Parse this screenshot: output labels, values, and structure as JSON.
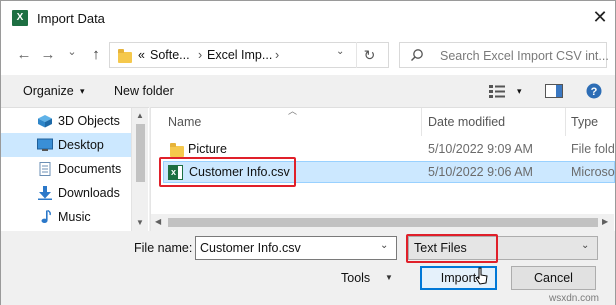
{
  "window": {
    "title": "Import Data",
    "close_glyph": "✕",
    "app_icon_letter": "X"
  },
  "nav": {
    "back_glyph": "←",
    "forward_glyph": "→",
    "recent_glyph": "⌄",
    "up_glyph": "↑",
    "breadcrumb_prefix": "«",
    "breadcrumbs": [
      "Softe...",
      "Excel Imp..."
    ],
    "crumb_sep": "›",
    "refresh_glyph": "↻",
    "search_placeholder": "Search Excel Import CSV int..."
  },
  "toolbar": {
    "organize_label": "Organize",
    "organize_caret": "▾",
    "new_folder_label": "New folder",
    "view_caret": "▾"
  },
  "sidebar": {
    "items": [
      {
        "label": "3D Objects",
        "icon": "3d-objects-icon"
      },
      {
        "label": "Desktop",
        "icon": "desktop-icon",
        "selected": true
      },
      {
        "label": "Documents",
        "icon": "documents-icon"
      },
      {
        "label": "Downloads",
        "icon": "downloads-icon"
      },
      {
        "label": "Music",
        "icon": "music-icon"
      }
    ]
  },
  "file_list": {
    "columns": [
      "Name",
      "Date modified",
      "Type"
    ],
    "rows": [
      {
        "name": "Picture",
        "date": "5/10/2022 9:09 AM",
        "type": "File fold",
        "icon": "folder-icon"
      },
      {
        "name": "Customer Info.csv",
        "date": "5/10/2022 9:06 AM",
        "type": "Microso",
        "icon": "excel-csv-icon",
        "selected": true
      }
    ]
  },
  "footer": {
    "file_name_label": "File name:",
    "file_name_value": "Customer Info.csv",
    "filter_value": "Text Files",
    "tools_label": "Tools",
    "import_label": "Import",
    "cancel_label": "Cancel"
  },
  "watermark": "wsxdn.com",
  "colors": {
    "highlight": "#e0202a",
    "selection": "#cce8ff",
    "excel_green": "#1d6f42"
  }
}
